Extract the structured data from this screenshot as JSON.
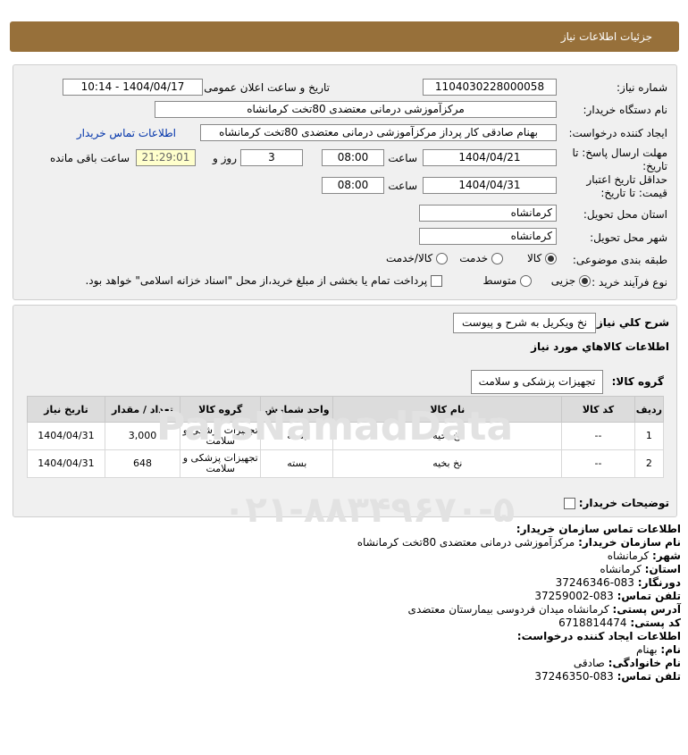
{
  "header": {
    "title": "جزئیات اطلاعات نیاز"
  },
  "form": {
    "need_number_label": "شماره نیاز:",
    "need_number": "1104030228000058",
    "announce_label": "تاریخ و ساعت اعلان عمومی:",
    "announce_value": "1404/04/17 - 10:14",
    "buyer_org_label": "نام دستگاه خریدار:",
    "buyer_org": "مرکزآموزشی درمانی معتضدی 80تخت کرمانشاه",
    "creator_label": "ایجاد کننده درخواست:",
    "creator": "بهنام صادقی کار پرداز مرکزآموزشی درمانی معتضدی 80تخت کرمانشاه",
    "buyer_contact_link": "اطلاعات تماس خریدار",
    "deadline_label_1": "مهلت ارسال پاسخ: تا",
    "deadline_label_2": "تاریخ:",
    "deadline_date": "1404/04/21",
    "time_label": "ساعت",
    "deadline_time": "08:00",
    "days_value": "3",
    "days_label": "روز و",
    "remaining_time": "21:29:01",
    "remaining_label": "ساعت باقی مانده",
    "validity_label_1": "حداقل تاریخ اعتبار",
    "validity_label_2": "قیمت: تا تاریخ:",
    "validity_date": "1404/04/31",
    "validity_time": "08:00",
    "province_label": "استان محل تحویل:",
    "province": "کرمانشاه",
    "city_label": "شهر محل تحویل:",
    "city": "کرمانشاه",
    "category_label": "طبقه بندی موضوعی:",
    "category_options": [
      "کالا",
      "خدمت",
      "کالا/خدمت"
    ],
    "category_selected": "کالا",
    "process_label": "نوع فرآیند خرید :",
    "process_options": [
      "جزیی",
      "متوسط"
    ],
    "process_selected": "جزیی",
    "payment_note": "پرداخت تمام یا بخشی از مبلغ خرید،از محل \"اسناد خزانه اسلامی\" خواهد بود."
  },
  "summary": {
    "need_desc_label": "شرح کلي نياز:",
    "need_desc": "نخ ویکریل به شرح و پیوست",
    "goods_info_title": "اطلاعات کالاهاي مورد نياز",
    "goods_group_label": "گروه کالا:",
    "goods_group": "تجهیزات پزشکی و سلامت",
    "buyer_notes_label": "توضیحات خریدار:"
  },
  "table": {
    "headers": [
      "ردیف",
      "کد کالا",
      "نام کالا",
      "واحد شمارش",
      "گروه کالا",
      "تعداد / مقدار",
      "تاریخ نیاز"
    ],
    "rows": [
      {
        "row": "1",
        "code": "--",
        "name": "نخ بخیه",
        "unit": "بسته",
        "group": "تجهیزات پزشکی و سلامت",
        "qty": "3,000",
        "date": "1404/04/31"
      },
      {
        "row": "2",
        "code": "--",
        "name": "نخ بخیه",
        "unit": "بسته",
        "group": "تجهیزات پزشکی و سلامت",
        "qty": "648",
        "date": "1404/04/31"
      }
    ]
  },
  "contact": {
    "title": "اطلاعات تماس سازمان خریدار:",
    "org_label": "نام سازمان خریدار:",
    "org": "مرکزآموزشی درمانی معتضدی 80تخت کرمانشاه",
    "city_label": "شهر:",
    "city": "کرمانشاه",
    "province_label": "استان:",
    "province": "کرمانشاه",
    "fax_label": "دورنگار:",
    "fax": "083-37246346",
    "phone_label": "تلفن تماس:",
    "phone": "083-37259002",
    "address_label": "آدرس پستی:",
    "address": "کرمانشاه میدان فردوسی بیمارستان معتضدی",
    "postal_label": "کد پستی:",
    "postal": "6718814474",
    "creator_title": "اطلاعات ایجاد کننده درخواست:",
    "name_label": "نام:",
    "name": "بهنام",
    "family_label": "نام خانوادگی:",
    "family": "صادقی",
    "creator_phone_label": "تلفن تماس:",
    "creator_phone": "083-37246350"
  },
  "watermark": {
    "brand": "ParsNamadData",
    "phone": "۰۲۱-۸۸۳۴۹۶۷۰-۵"
  }
}
